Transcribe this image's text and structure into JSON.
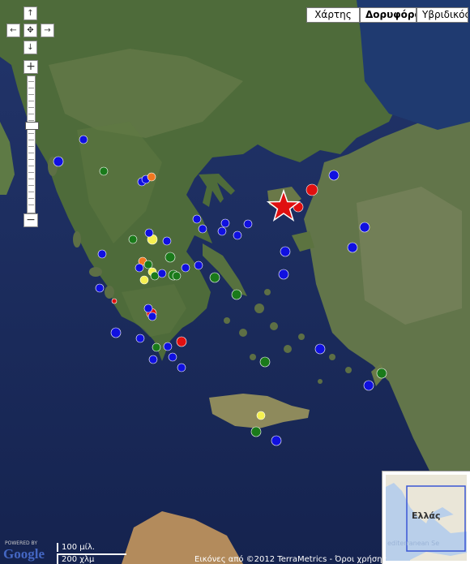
{
  "map_type": {
    "options": [
      "Χάρτης",
      "Δορυφόρος",
      "Υβριδικός"
    ],
    "selected": "Δορυφόρος"
  },
  "pan_controls": {
    "up": "↑",
    "left": "←",
    "center": "✥",
    "right": "→",
    "down": "↓"
  },
  "zoom_controls": {
    "plus": "+",
    "minus": "−",
    "level_fraction": 0.65
  },
  "overview": {
    "label": "Ελλάς",
    "sea_label": "editerranean Se"
  },
  "scale": {
    "imperial": "100 μίλ.",
    "metric": "200 χλμ"
  },
  "attribution": "Εικόνες από ©2012 TerraMetrics - Όροι χρήσης",
  "branding": {
    "powered": "POWERED BY",
    "google": "Google"
  },
  "marker_colors": {
    "blue": "#1010e0",
    "green": "#1a7a1a",
    "red": "#e01010",
    "yellow": "#f5f050",
    "orange": "#f07820",
    "star": "#e01010"
  },
  "markers": [
    {
      "color": "blue"
    },
    {
      "color": "blue"
    },
    {
      "color": "green"
    },
    {
      "color": "blue"
    },
    {
      "color": "blue"
    },
    {
      "color": "orange"
    },
    {
      "color": "blue"
    },
    {
      "color": "blue"
    },
    {
      "color": "blue"
    },
    {
      "color": "blue"
    },
    {
      "color": "blue"
    },
    {
      "color": "green"
    },
    {
      "color": "yellow"
    },
    {
      "color": "blue"
    },
    {
      "color": "blue"
    },
    {
      "color": "blue"
    },
    {
      "color": "orange"
    },
    {
      "color": "green"
    },
    {
      "color": "yellow"
    },
    {
      "color": "yellow"
    },
    {
      "color": "blue"
    },
    {
      "color": "green"
    },
    {
      "color": "green"
    },
    {
      "color": "blue"
    },
    {
      "color": "blue"
    },
    {
      "color": "green"
    },
    {
      "color": "green"
    },
    {
      "color": "blue"
    },
    {
      "color": "red"
    },
    {
      "color": "blue"
    },
    {
      "color": "red"
    },
    {
      "color": "blue"
    },
    {
      "color": "blue"
    },
    {
      "color": "green"
    },
    {
      "color": "blue"
    },
    {
      "color": "red"
    },
    {
      "color": "blue"
    },
    {
      "color": "blue"
    },
    {
      "color": "blue"
    },
    {
      "color": "blue"
    },
    {
      "color": "blue"
    },
    {
      "color": "blue"
    },
    {
      "color": "red"
    },
    {
      "color": "red"
    },
    {
      "color": "blue"
    },
    {
      "color": "blue"
    },
    {
      "color": "blue"
    },
    {
      "color": "blue"
    },
    {
      "color": "blue"
    },
    {
      "color": "blue"
    },
    {
      "color": "green"
    },
    {
      "color": "blue"
    },
    {
      "color": "green"
    },
    {
      "color": "blue"
    },
    {
      "color": "green"
    },
    {
      "color": "yellow"
    },
    {
      "color": "green"
    },
    {
      "color": "blue"
    },
    {
      "color": "green"
    }
  ],
  "epicenter": {
    "color": "star"
  }
}
